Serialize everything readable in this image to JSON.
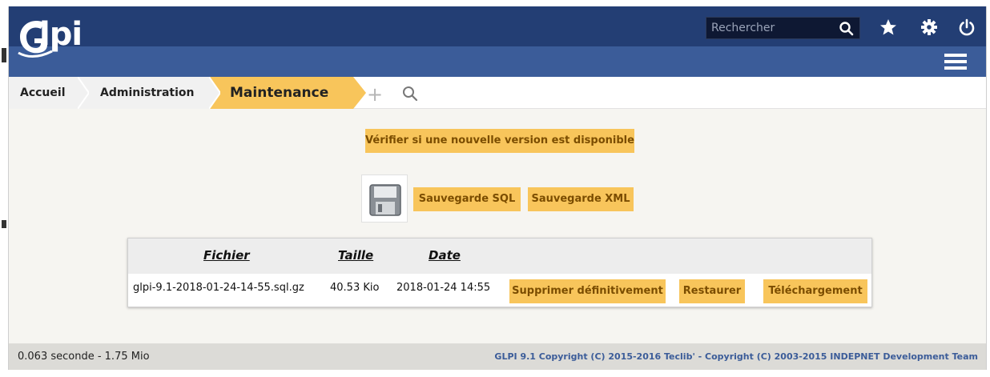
{
  "header": {
    "logo_text": "lpi",
    "search_placeholder": "Rechercher",
    "icons": [
      "search-icon",
      "star-icon",
      "gear-icon",
      "power-icon",
      "hamburger-menu-icon"
    ]
  },
  "breadcrumb": {
    "items": [
      "Accueil",
      "Administration",
      "Maintenance"
    ],
    "actions": [
      "plus-icon",
      "search-icon"
    ]
  },
  "main": {
    "check_version_label": "Vérifier si une nouvelle version est disponible",
    "backup_sql_label": "Sauvegarde SQL",
    "backup_xml_label": "Sauvegarde XML"
  },
  "backups": {
    "columns": [
      "Fichier",
      "Taille",
      "Date"
    ],
    "rows": [
      {
        "file": "glpi-9.1-2018-01-24-14-55.sql.gz",
        "size": "40.53 Kio",
        "date": "2018-01-24 14:55",
        "delete_label": "Supprimer définitivement",
        "restore_label": "Restaurer",
        "download_label": "Téléchargement"
      }
    ]
  },
  "footer": {
    "timing": "0.063 seconde - 1.75 Mio",
    "copyright": "GLPI 9.1 Copyright (C) 2015-2016 Teclib' - Copyright (C) 2003-2015 INDEPNET Development Team"
  },
  "colors": {
    "header_dark": "#233e74",
    "header_light": "#3b5c99",
    "accent": "#f8c55b",
    "background": "#f6f5f1"
  }
}
